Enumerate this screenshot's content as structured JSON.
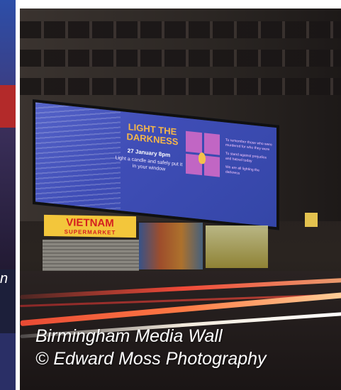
{
  "left_panel": {
    "cropped_caption_fragment": "n"
  },
  "billboard": {
    "title": "LIGHT THE DARKNESS",
    "date": "27 January 8pm",
    "subtitle": "Light a candle and safely put it in your window",
    "right_text": [
      "To remember those who were murdered for who they were",
      "To stand against prejudice and hatred today",
      "We are all lighting the darkness"
    ]
  },
  "storefront": {
    "name": "VIETNAM",
    "sub": "SUPERMARKET"
  },
  "caption": {
    "line1": "Birmingham Media Wall",
    "line2": "© Edward Moss Photography"
  },
  "colors": {
    "screen_blue": "#4553bd",
    "title_orange": "#f5b74a",
    "icon_purple": "#c166c4",
    "shop_yellow": "#f3c63b",
    "shop_red": "#d41f1f",
    "light_trail_red": "#f04a38"
  }
}
